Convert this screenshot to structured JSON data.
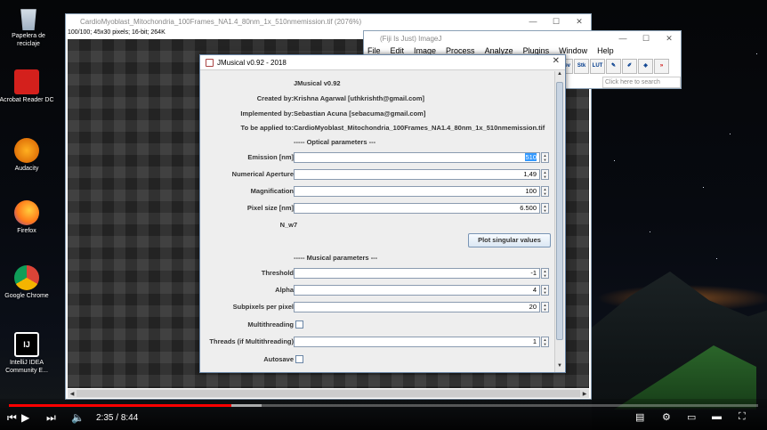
{
  "desktop": {
    "icons": [
      {
        "label": "Papelera de reciclaje",
        "icon": "recycle-bin-icon"
      },
      {
        "label": "Acrobat Reader DC",
        "icon": "acrobat-icon"
      },
      {
        "label": "Audacity",
        "icon": "audacity-icon"
      },
      {
        "label": "Firefox",
        "icon": "firefox-icon"
      },
      {
        "label": "Google Chrome",
        "icon": "chrome-icon"
      },
      {
        "label": "IntelliJ IDEA Community E...",
        "icon": "intellij-icon"
      }
    ]
  },
  "image_window": {
    "title": "CardioMyoblast_Mitochondria_100Frames_NA1.4_80nm_1x_510nmemission.tif (2076%)",
    "info": "100/100; 45x30 pixels; 16-bit; 264K"
  },
  "fiji": {
    "title": "(Fiji Is Just) ImageJ",
    "menu": [
      "File",
      "Edit",
      "Image",
      "Process",
      "Analyze",
      "Plugins",
      "Window",
      "Help"
    ],
    "tools": [
      "Dev",
      "Stk",
      "LUT",
      "pen",
      "brush",
      "fill",
      ">>"
    ],
    "search_placeholder": "Click here to search"
  },
  "jmusical": {
    "title": "JMusical v0.92 - 2018",
    "header": "JMusical v0.92",
    "created_by_label": "Created by:",
    "created_by": "Krishna Agarwal [uthkrishth@gmail.com]",
    "implemented_by_label": "Implemented by:",
    "implemented_by": "Sebastian Acuna [sebacuma@gmail.com]",
    "applied_label": "To be applied to:",
    "applied_to": "CardioMyoblast_Mitochondria_100Frames_NA1.4_80nm_1x_510nmemission.tif",
    "optical_section": "----- Optical parameters ---",
    "emission_label": "Emission [nm]",
    "emission": "510",
    "na_label": "Numerical Aperture",
    "na": "1,49",
    "magnification_label": "Magnification",
    "magnification": "100",
    "pixel_label": "Pixel size [nm]",
    "pixel": "6.500",
    "nw_label": "N_w",
    "nw": "7",
    "plot_button": "Plot singular values",
    "musical_section": "----- Musical parameters ---",
    "threshold_label": "Threshold",
    "threshold": "-1",
    "alpha_label": "Alpha",
    "alpha": "4",
    "subpixels_label": "Subpixels per pixel",
    "subpixels": "20",
    "multithreading_label": "Multithreading",
    "threads_label": "Threads (if Multithreading)",
    "threads": "1",
    "autosave_label": "Autosave"
  },
  "player": {
    "current_time": "2:35",
    "duration": "8:44",
    "progress_fraction": 0.297
  }
}
